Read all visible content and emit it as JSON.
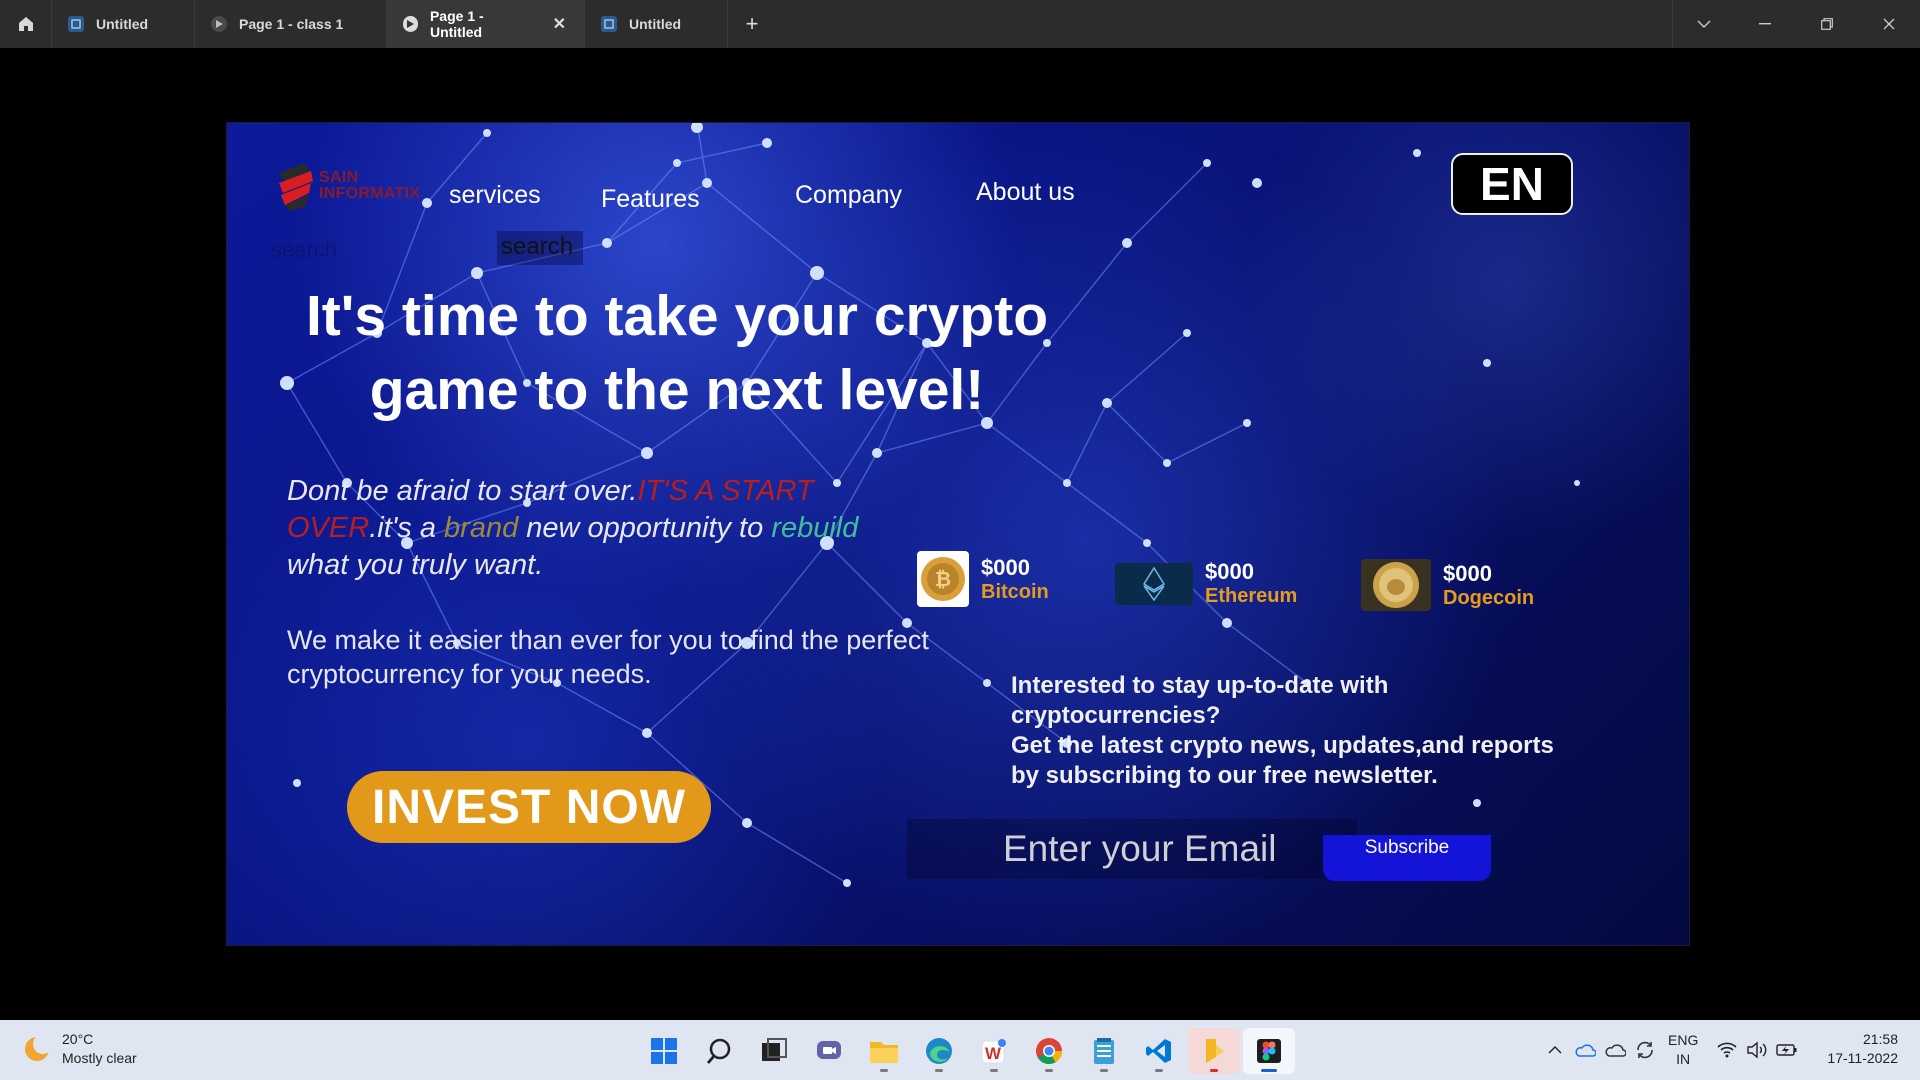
{
  "tabs": [
    {
      "label": "Untitled",
      "icon": "figma-file-icon"
    },
    {
      "label": "Page 1 - class 1",
      "icon": "play-icon"
    },
    {
      "label": "Page 1 - Untitled",
      "icon": "play-icon",
      "active": true
    },
    {
      "label": "Untitled",
      "icon": "figma-file-icon"
    }
  ],
  "tab_close": "✕",
  "add_tab": "+",
  "site": {
    "logo_line1": "SAIN",
    "logo_line2": "INFORMATIX",
    "nav": [
      "services",
      "Features",
      "Company",
      "About us"
    ],
    "language": "EN",
    "search_ghost": "search",
    "search_label": "search",
    "hero_title_line1": "It's time to take your crypto",
    "hero_title_line2": "game to the next level!",
    "tagline": {
      "part1": "Dont be afraid to start over.",
      "part2": "IT'S A START",
      "part3": "OVER",
      "part4": ".it's a ",
      "part5": "brand",
      "part6": " new opportunity to ",
      "part7": "rebuild",
      "part8": "what you truly want."
    },
    "subtext": " We make it easier than ever for you to find the perfect cryptocurrency for your needs.",
    "invest_label": "INVEST NOW",
    "coins": [
      {
        "price": "$000",
        "name": "Bitcoin"
      },
      {
        "price": "$000",
        "name": "Ethereum"
      },
      {
        "price": "$000",
        "name": "Dogecoin"
      }
    ],
    "newsletter": {
      "line1": "Interested to stay up-to-date with",
      "line2": "cryptocurrencies?",
      "line3": "Get the latest crypto news, updates,and reports",
      "line4": "by subscribing to our free newsletter."
    },
    "email_placeholder": "Enter your Email",
    "subscribe_label": "Subscribe"
  },
  "colors": {
    "accent_orange": "#e2991a",
    "subscribe_blue": "#1414d8",
    "tagline_red": "#b81e1e",
    "tagline_green": "#3fbf9a"
  },
  "taskbar": {
    "temperature": "20°C",
    "weather": "Mostly clear",
    "apps": [
      "start-icon",
      "search-icon",
      "task-view-icon",
      "chat-icon",
      "file-explorer-icon",
      "edge-icon",
      "wps-icon",
      "chrome-icon",
      "notepad-icon",
      "vscode-icon",
      "folder-app-icon",
      "figma-icon"
    ],
    "lang_line1": "ENG",
    "lang_line2": "IN",
    "time": "21:58",
    "date": "17-11-2022"
  }
}
